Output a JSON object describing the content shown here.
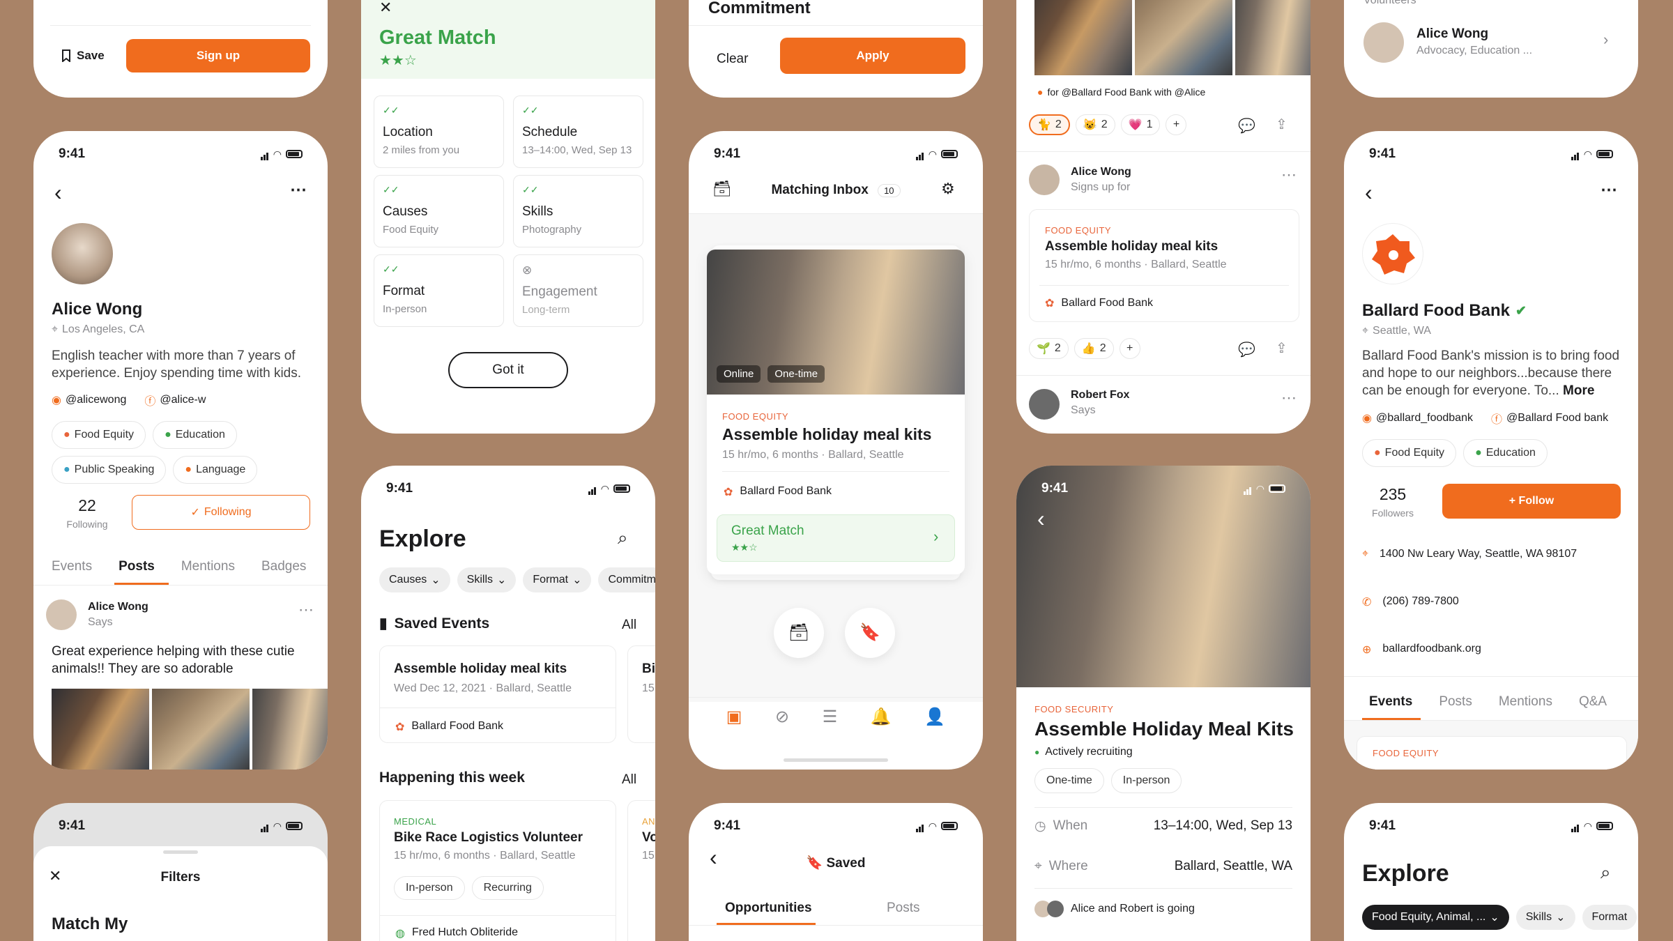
{
  "c1": {
    "save": "Save",
    "signup": "Sign up"
  },
  "c2": {
    "title": "Great Match",
    "items": [
      {
        "title": "Location",
        "sub": "2 miles from you"
      },
      {
        "title": "Schedule",
        "sub": "13–14:00, Wed, Sep 13"
      },
      {
        "title": "Causes",
        "sub": "Food Equity"
      },
      {
        "title": "Skills",
        "sub": "Photography"
      },
      {
        "title": "Format",
        "sub": "In-person"
      },
      {
        "title": "Engagement",
        "sub": "Long-term"
      }
    ],
    "got": "Got it"
  },
  "c3": {
    "title": "Commitment",
    "clear": "Clear",
    "apply": "Apply"
  },
  "c4": {
    "mention": "for @Ballard Food Bank with @Alice",
    "r1": "2",
    "r2": "2",
    "r3": "1"
  },
  "c5": {
    "label": "Volunteers",
    "name": "Alice Wong",
    "sub": "Advocacy, Education ..."
  },
  "p1": {
    "time": "9:41",
    "name": "Alice Wong",
    "loc": "Los Angeles, CA",
    "bio": "English teacher with more than 7 years of experience. Enjoy spending time with kids.",
    "ig": "@alicewong",
    "fb": "@alice-w",
    "tags": [
      "Food Equity",
      "Education",
      "Public Speaking",
      "Language"
    ],
    "count": "22",
    "count_label": "Following",
    "following": "Following",
    "tabs": [
      "Events",
      "Posts",
      "Mentions",
      "Badges"
    ],
    "post_name": "Alice Wong",
    "post_says": "Says",
    "post_text": "Great experience helping with these cutie animals!! They are so adorable"
  },
  "p2": {
    "time": "9:41",
    "title": "Explore",
    "filters": [
      "Causes",
      "Skills",
      "Format",
      "Commitm"
    ],
    "saved": "Saved Events",
    "all": "All",
    "e1_title": "Assemble holiday meal kits",
    "e1_sub": "Wed Dec 12, 2021 · Ballard, Seattle",
    "e1_org": "Ballard Food Bank",
    "e2_title": "Bi",
    "e2_sub": "15",
    "week": "Happening this week",
    "all2": "All",
    "w1_tag": "MEDICAL",
    "w1_title": "Bike Race Logistics Volunteer",
    "w1_sub": "15 hr/mo, 6 months · Ballard, Seattle",
    "w1_chips": [
      "In-person",
      "Recurring"
    ],
    "w1_org": "Fred Hutch Obliteride",
    "w2_tag": "AN",
    "w2_title": "Vo",
    "w2_sub": "15"
  },
  "p3": {
    "time": "9:41",
    "title": "Matching Inbox",
    "count": "10",
    "badges": [
      "Online",
      "One-time"
    ],
    "tag": "FOOD EQUITY",
    "ev_title": "Assemble holiday meal kits",
    "ev_sub": "15 hr/mo, 6 months · Ballard, Seattle",
    "org": "Ballard Food Bank",
    "match": "Great Match"
  },
  "p4": {
    "n1": "Alice Wong",
    "s1": "Signs up for",
    "tag": "FOOD EQUITY",
    "ev_title": "Assemble holiday meal kits",
    "ev_sub": "15 hr/mo, 6 months · Ballard, Seattle",
    "org": "Ballard Food Bank",
    "r1": "2",
    "r2": "2",
    "n2": "Robert Fox",
    "s2": "Says"
  },
  "p5": {
    "time": "9:41",
    "name": "Ballard Food Bank",
    "loc": "Seattle, WA",
    "bio1": "Ballard Food Bank's mission is to bring food and hope to our neighbors...because there can be enough for everyone. To... ",
    "more": "More",
    "ig": "@ballard_foodbank",
    "fb": "@Ballard Food bank",
    "tags": [
      "Food Equity",
      "Education"
    ],
    "count": "235",
    "count_label": "Followers",
    "follow": "+ Follow",
    "addr": "1400 Nw Leary Way, Seattle, WA 98107",
    "phone": "(206) 789-7800",
    "web": "ballardfoodbank.org",
    "tabs": [
      "Events",
      "Posts",
      "Mentions",
      "Q&A"
    ],
    "tag": "FOOD EQUITY"
  },
  "p6": {
    "time": "9:41",
    "title": "Filters",
    "match": "Match My"
  },
  "p7": {
    "time": "9:41",
    "title": "Saved",
    "tabs": [
      "Opportunities",
      "Posts"
    ]
  },
  "p8": {
    "time": "9:41",
    "tag": "FOOD SECURITY",
    "title": "Assemble Holiday Meal Kits",
    "status": "Actively recruiting",
    "chips": [
      "One-time",
      "In-person"
    ],
    "when": "When",
    "when_val": "13–14:00, Wed, Sep 13",
    "where": "Where",
    "where_val": "Ballard, Seattle, WA",
    "going": "Alice and Robert is going"
  },
  "p9": {
    "time": "9:41",
    "title": "Explore",
    "filters": [
      "Food Equity, Animal, ...",
      "Skills",
      "Format"
    ]
  }
}
